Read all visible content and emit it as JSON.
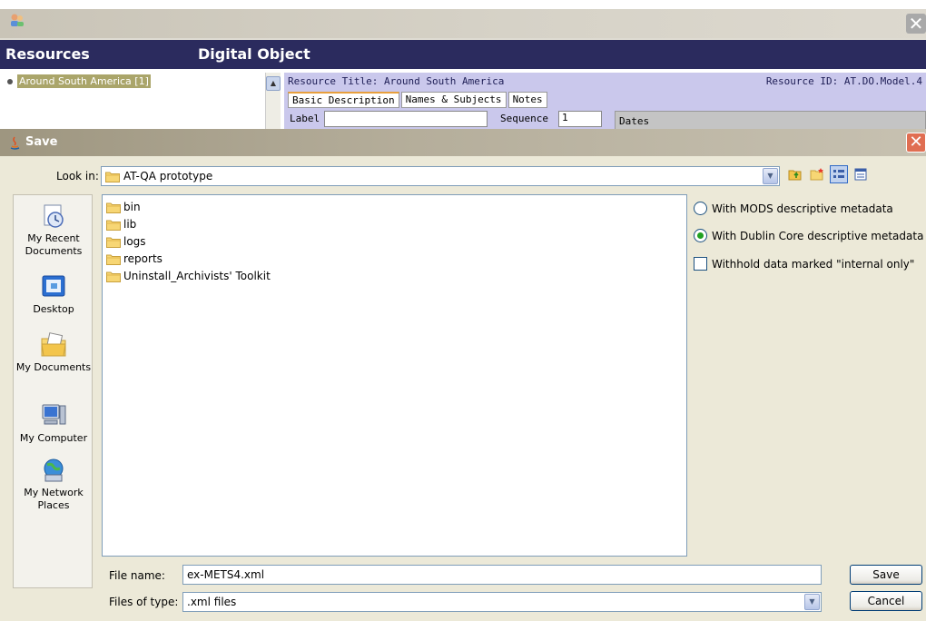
{
  "background_app": {
    "header": {
      "resources_label": "Resources",
      "digital_object_label": "Digital Object"
    },
    "tree_item": "Around South America [1]",
    "resource_title": "Resource Title:  Around South America",
    "resource_id": "Resource ID:  AT.DO.Model.4",
    "tabs": [
      "Basic Description",
      "Names & Subjects",
      "Notes"
    ],
    "label_label": "Label",
    "sequence_label": "Sequence",
    "sequence_value": "1",
    "dates_label": "Dates"
  },
  "dialog": {
    "title": "Save",
    "look_in_label": "Look in:",
    "look_in_value": "AT-QA prototype",
    "places": [
      {
        "label": "My Recent Documents",
        "icon": "recent-documents-icon"
      },
      {
        "label": "Desktop",
        "icon": "desktop-icon"
      },
      {
        "label": "My Documents",
        "icon": "my-documents-icon"
      },
      {
        "label": "My Computer",
        "icon": "my-computer-icon"
      },
      {
        "label": "My Network Places",
        "icon": "network-places-icon"
      }
    ],
    "files": [
      "bin",
      "lib",
      "logs",
      "reports",
      "Uninstall_Archivists' Toolkit"
    ],
    "options": {
      "mods": "With MODS descriptive metadata",
      "dublin_core": "With Dublin Core descriptive metadata",
      "withhold": "Withhold data marked \"internal only\"",
      "selected": "dublin_core"
    },
    "file_name_label": "File name:",
    "file_name_value": "ex-METS4.xml",
    "file_type_label": "Files of type:",
    "file_type_value": ".xml files",
    "save_button": "Save",
    "cancel_button": "Cancel"
  },
  "colors": {
    "header_bg": "#2b2b5e",
    "resource_panel_bg": "#cac8ec",
    "dialog_bg": "#ece9d8",
    "selection_bg": "#aaa56a"
  }
}
